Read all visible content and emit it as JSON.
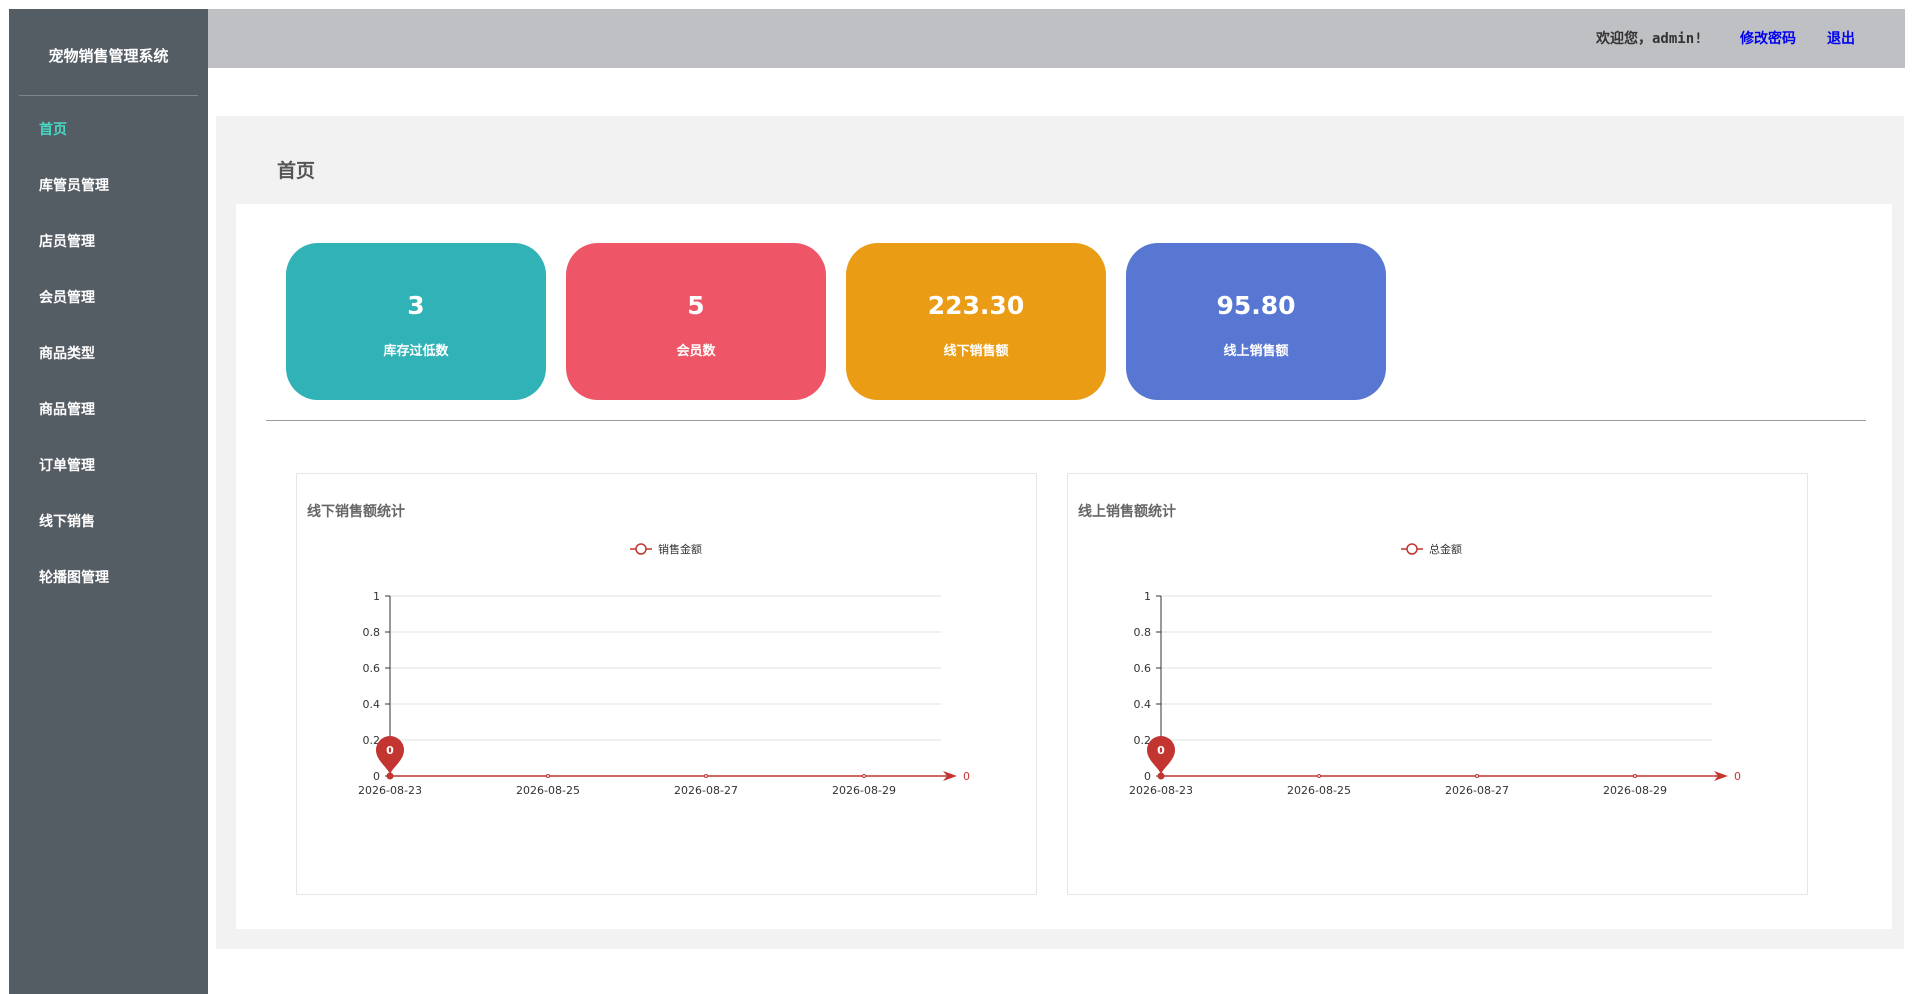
{
  "app": {
    "brand": "宠物销售管理系统"
  },
  "header": {
    "welcome": "欢迎您，admin!",
    "change_password": "修改密码",
    "logout": "退出"
  },
  "sidebar": {
    "items": [
      {
        "label": "首页",
        "active": true
      },
      {
        "label": "库管员管理"
      },
      {
        "label": "店员管理"
      },
      {
        "label": "会员管理"
      },
      {
        "label": "商品类型"
      },
      {
        "label": "商品管理"
      },
      {
        "label": "订单管理"
      },
      {
        "label": "线下销售"
      },
      {
        "label": "轮播图管理"
      }
    ]
  },
  "main": {
    "page_title": "首页",
    "cards": [
      {
        "value": "3",
        "label": "库存过低数",
        "color": "#31b2b7"
      },
      {
        "value": "5",
        "label": "会员数",
        "color": "#ee5667"
      },
      {
        "value": "223.30",
        "label": "线下销售额",
        "color": "#ea9c15"
      },
      {
        "value": "95.80",
        "label": "线上销售额",
        "color": "#5877d2"
      }
    ]
  },
  "colors": {
    "sidebar_bg": "#545c64",
    "active_menu": "#47d8c3",
    "header_bg": "#bfc0c4",
    "series": "#c23531"
  },
  "chart_data": [
    {
      "type": "line",
      "title": "线下销售额统计",
      "series": [
        {
          "name": "销售金额",
          "values": [
            0
          ]
        }
      ],
      "x": [
        "2026-08-23"
      ],
      "xticks": [
        "2026-08-23",
        "2026-08-25",
        "2026-08-27",
        "2026-08-29"
      ],
      "ylim": [
        0,
        1
      ],
      "yticks": [
        "0",
        "0.2",
        "0.4",
        "0.6",
        "0.8",
        "1"
      ],
      "markpoint": "0",
      "end_label": "0",
      "legend": "top-center",
      "grid": true
    },
    {
      "type": "line",
      "title": "线上销售额统计",
      "series": [
        {
          "name": "总金额",
          "values": [
            0
          ]
        }
      ],
      "x": [
        "2026-08-23"
      ],
      "xticks": [
        "2026-08-23",
        "2026-08-25",
        "2026-08-27",
        "2026-08-29"
      ],
      "ylim": [
        0,
        1
      ],
      "yticks": [
        "0",
        "0.2",
        "0.4",
        "0.6",
        "0.8",
        "1"
      ],
      "markpoint": "0",
      "end_label": "0",
      "legend": "top-center",
      "grid": true
    }
  ]
}
